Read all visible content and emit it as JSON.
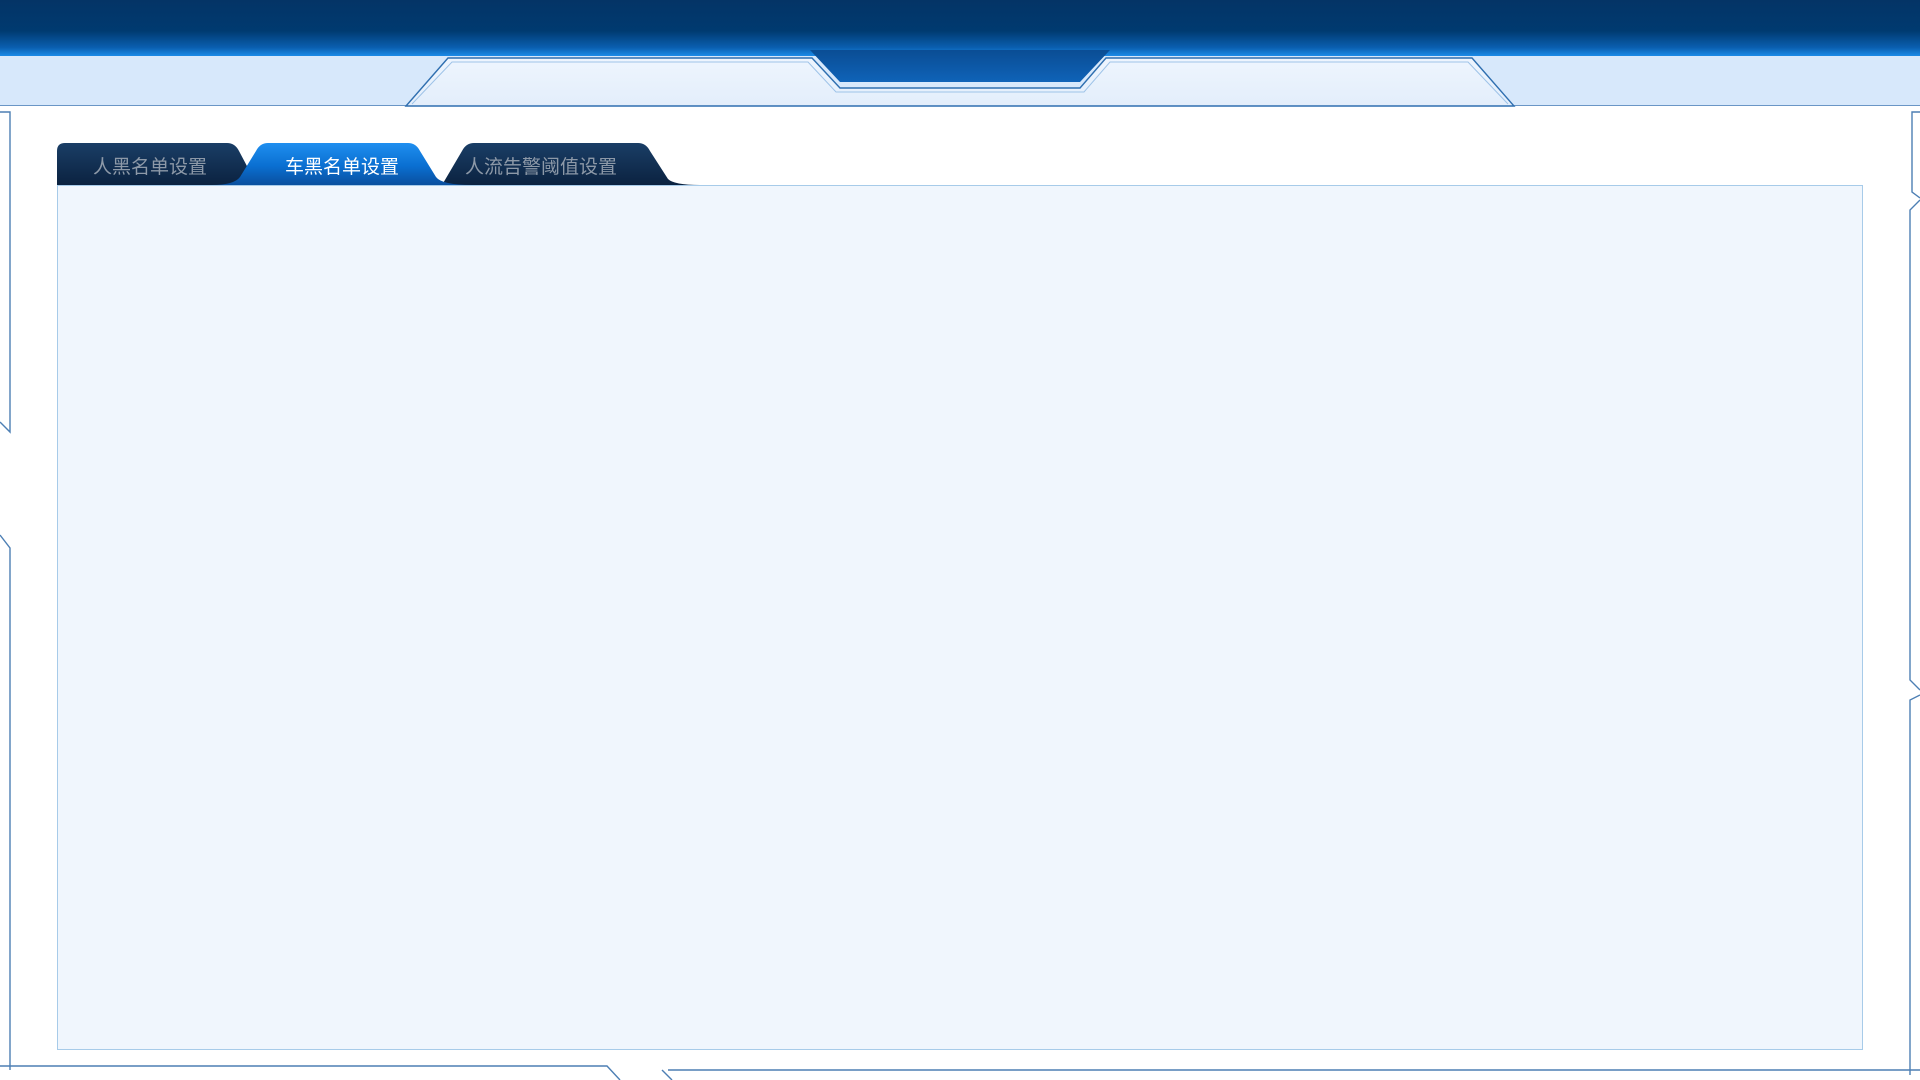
{
  "tabs": [
    {
      "label": "人黑名单设置",
      "active": false
    },
    {
      "label": "车黑名单设置",
      "active": true
    },
    {
      "label": "人流告警阈值设置",
      "active": false
    }
  ],
  "colors": {
    "header_dark": "#043466",
    "header_glow": "#1b8be8",
    "subbar": "#d7e8fb",
    "panel_bg": "#f0f6fd",
    "panel_border": "#a7cbe9",
    "tab_inactive": "#0e2a4d",
    "tab_active": "#0a6fd1"
  }
}
